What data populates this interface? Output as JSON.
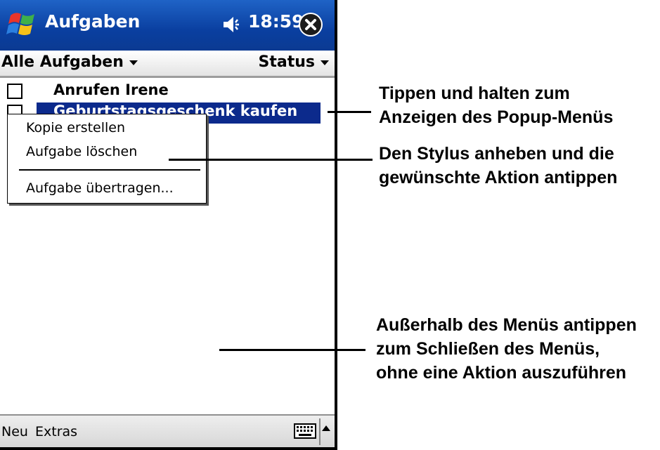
{
  "titlebar": {
    "app_title": "Aufgaben",
    "time": "18:59",
    "icons": [
      "windows-start-icon",
      "speaker-icon",
      "close-icon"
    ],
    "accent_color": "#0b3fa0"
  },
  "header": {
    "filter": "Alle Aufgaben",
    "sort": "Status"
  },
  "tasks": [
    {
      "label": "Anrufen Irene",
      "selected": false
    },
    {
      "label": "Geburtstagsgeschenk kaufen",
      "selected": true
    }
  ],
  "popup_menu": {
    "items": [
      "Kopie erstellen",
      "Aufgabe löschen",
      "Aufgabe übertragen..."
    ]
  },
  "menubar": {
    "items": [
      "Neu",
      "Extras"
    ],
    "icons": [
      "keyboard-icon",
      "sip-up-arrow-icon"
    ]
  },
  "callouts": [
    {
      "lines": [
        "Tippen und halten zum",
        "Anzeigen des Popup-Menüs"
      ]
    },
    {
      "lines": [
        "Den Stylus anheben und die",
        "gewünschte Aktion antippen"
      ]
    },
    {
      "lines": [
        "Außerhalb des Menüs antippen",
        "zum Schließen des Menüs,",
        "ohne eine Aktion auszuführen"
      ]
    }
  ]
}
